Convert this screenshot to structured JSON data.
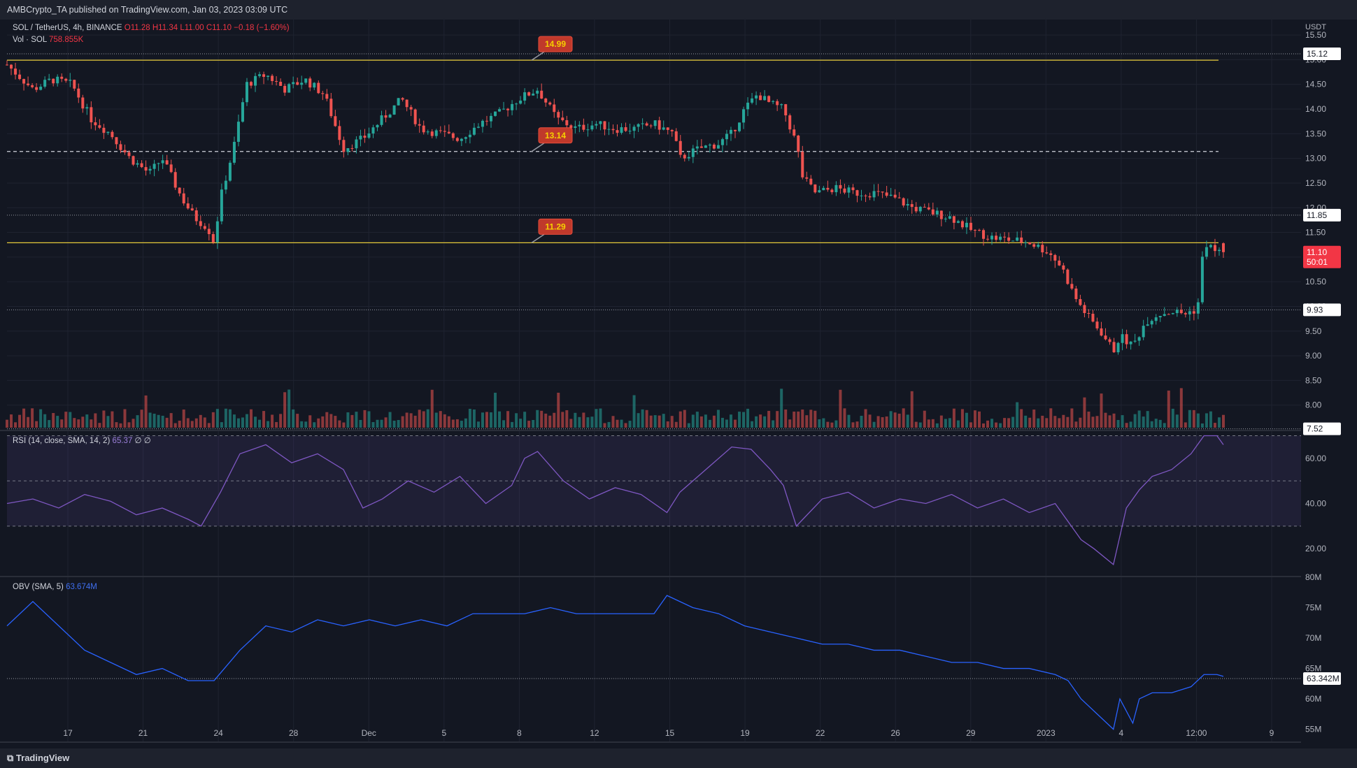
{
  "header": {
    "published": "AMBCrypto_TA published on TradingView.com, Jan 03, 2023 03:09 UTC"
  },
  "legend": {
    "symbol": "SOL / TetherUS, 4h, BINANCE",
    "o": "O11.28",
    "h": "H11.34",
    "l": "L11.00",
    "c": "C11.10",
    "change": "−0.18 (−1.60%)",
    "vol_label": "Vol · SOL",
    "vol_value": "758.855K",
    "rsi_label": "RSI (14, close, SMA, 14, 2)",
    "rsi_value": "65.37",
    "rsi_extra": "∅ ∅",
    "obv_label": "OBV (SMA, 5)",
    "obv_value": "63.674M"
  },
  "footer": {
    "brand": "TradingView"
  },
  "colors": {
    "background": "#131722",
    "up": "#26a69a",
    "down": "#ef5350",
    "level": "#e5c93a",
    "rsi": "#7e57c2",
    "obv": "#2962ff"
  },
  "chart_data": [
    {
      "type": "candlestick",
      "currency": "USDT",
      "y_ticks": [
        15.5,
        15.0,
        14.5,
        14.0,
        13.5,
        13.0,
        12.5,
        12.0,
        11.5,
        11.0,
        10.5,
        10.0,
        9.5,
        9.0,
        8.5,
        8.0
      ],
      "ylim": [
        7.5,
        15.7
      ],
      "x_labels": [
        "17",
        "21",
        "24",
        "28",
        "Dec",
        "5",
        "8",
        "12",
        "15",
        "19",
        "22",
        "26",
        "29",
        "2023",
        "4",
        "12:00",
        "9"
      ],
      "ohlc_current": {
        "open": 11.28,
        "high": 11.34,
        "low": 11.0,
        "close": 11.1
      },
      "price_badges": [
        "15.12",
        "11.85",
        "11.10",
        "9.93",
        "7.52"
      ],
      "countdown": "50:01",
      "levels": [
        {
          "label": "14.99",
          "value": 14.99,
          "style": "solid"
        },
        {
          "label": "13.14",
          "value": 13.14,
          "style": "dashed"
        },
        {
          "label": "11.29",
          "value": 11.29,
          "style": "solid"
        }
      ],
      "dotted_lines": [
        15.12,
        11.85,
        9.93,
        7.52
      ],
      "close_path": [
        [
          0,
          14.9
        ],
        [
          0.02,
          14.4
        ],
        [
          0.035,
          14.6
        ],
        [
          0.05,
          14.5
        ],
        [
          0.065,
          13.8
        ],
        [
          0.08,
          13.5
        ],
        [
          0.095,
          13.0
        ],
        [
          0.11,
          12.7
        ],
        [
          0.12,
          13.0
        ],
        [
          0.135,
          12.2
        ],
        [
          0.145,
          11.8
        ],
        [
          0.155,
          11.6
        ],
        [
          0.16,
          11.3
        ],
        [
          0.165,
          12.2
        ],
        [
          0.175,
          13.2
        ],
        [
          0.185,
          14.5
        ],
        [
          0.2,
          14.7
        ],
        [
          0.215,
          14.4
        ],
        [
          0.23,
          14.6
        ],
        [
          0.245,
          14.3
        ],
        [
          0.26,
          13.2
        ],
        [
          0.275,
          13.4
        ],
        [
          0.29,
          13.8
        ],
        [
          0.305,
          14.2
        ],
        [
          0.32,
          13.6
        ],
        [
          0.335,
          13.5
        ],
        [
          0.35,
          13.4
        ],
        [
          0.365,
          13.7
        ],
        [
          0.38,
          13.9
        ],
        [
          0.395,
          14.2
        ],
        [
          0.41,
          14.4
        ],
        [
          0.425,
          13.8
        ],
        [
          0.44,
          13.6
        ],
        [
          0.455,
          13.7
        ],
        [
          0.47,
          13.6
        ],
        [
          0.485,
          13.6
        ],
        [
          0.5,
          13.7
        ],
        [
          0.515,
          13.5
        ],
        [
          0.52,
          13.0
        ],
        [
          0.535,
          13.2
        ],
        [
          0.55,
          13.3
        ],
        [
          0.56,
          13.5
        ],
        [
          0.57,
          14.0
        ],
        [
          0.58,
          14.3
        ],
        [
          0.59,
          14.1
        ],
        [
          0.6,
          14.0
        ],
        [
          0.61,
          13.3
        ],
        [
          0.615,
          12.6
        ],
        [
          0.625,
          12.3
        ],
        [
          0.64,
          12.4
        ],
        [
          0.655,
          12.3
        ],
        [
          0.67,
          12.3
        ],
        [
          0.685,
          12.2
        ],
        [
          0.7,
          12.0
        ],
        [
          0.715,
          11.9
        ],
        [
          0.73,
          11.8
        ],
        [
          0.745,
          11.55
        ],
        [
          0.76,
          11.4
        ],
        [
          0.775,
          11.35
        ],
        [
          0.79,
          11.3
        ],
        [
          0.805,
          11.1
        ],
        [
          0.815,
          10.8
        ],
        [
          0.825,
          10.2
        ],
        [
          0.835,
          9.8
        ],
        [
          0.845,
          9.5
        ],
        [
          0.855,
          9.1
        ],
        [
          0.86,
          9.4
        ],
        [
          0.87,
          9.2
        ],
        [
          0.88,
          9.7
        ],
        [
          0.89,
          9.85
        ],
        [
          0.9,
          9.9
        ],
        [
          0.91,
          9.85
        ],
        [
          0.92,
          9.95
        ],
        [
          0.925,
          11.3
        ],
        [
          0.935,
          11.1
        ],
        [
          0.94,
          11.1
        ]
      ],
      "volume_label": "Vol · SOL",
      "volume_current": "758.855K"
    },
    {
      "type": "line",
      "name": "RSI (14, close, SMA, 14, 2)",
      "current": "65.37",
      "y_ticks": [
        60,
        40,
        20
      ],
      "ylim": [
        8,
        72
      ],
      "band": [
        30,
        70
      ],
      "midline": 50,
      "x": [
        0,
        0.02,
        0.04,
        0.06,
        0.08,
        0.1,
        0.12,
        0.14,
        0.15,
        0.165,
        0.18,
        0.2,
        0.22,
        0.24,
        0.26,
        0.275,
        0.29,
        0.31,
        0.33,
        0.35,
        0.37,
        0.39,
        0.4,
        0.41,
        0.43,
        0.45,
        0.47,
        0.49,
        0.51,
        0.52,
        0.54,
        0.56,
        0.575,
        0.59,
        0.6,
        0.61,
        0.63,
        0.65,
        0.67,
        0.69,
        0.71,
        0.73,
        0.75,
        0.77,
        0.79,
        0.81,
        0.82,
        0.83,
        0.84,
        0.855,
        0.865,
        0.875,
        0.885,
        0.9,
        0.915,
        0.925,
        0.935,
        0.94
      ],
      "values": [
        40,
        42,
        38,
        44,
        41,
        35,
        38,
        33,
        30,
        45,
        62,
        66,
        58,
        62,
        55,
        38,
        42,
        50,
        45,
        52,
        40,
        48,
        60,
        63,
        50,
        42,
        47,
        44,
        36,
        45,
        55,
        65,
        64,
        55,
        48,
        30,
        42,
        45,
        38,
        42,
        40,
        44,
        38,
        42,
        36,
        40,
        32,
        24,
        20,
        13,
        38,
        46,
        52,
        55,
        62,
        70,
        70,
        66
      ]
    },
    {
      "type": "line",
      "name": "OBV (SMA, 5)",
      "current": "63.674M",
      "y_ticks": [
        "80M",
        "75M",
        "70M",
        "65M",
        "60M",
        "55M"
      ],
      "ylim": [
        53,
        80
      ],
      "badge": "63.342M",
      "x": [
        0,
        0.02,
        0.04,
        0.06,
        0.08,
        0.1,
        0.12,
        0.14,
        0.16,
        0.18,
        0.2,
        0.22,
        0.24,
        0.26,
        0.28,
        0.3,
        0.32,
        0.34,
        0.36,
        0.38,
        0.4,
        0.42,
        0.44,
        0.46,
        0.48,
        0.5,
        0.51,
        0.53,
        0.55,
        0.57,
        0.59,
        0.61,
        0.63,
        0.65,
        0.67,
        0.69,
        0.71,
        0.73,
        0.75,
        0.77,
        0.79,
        0.81,
        0.82,
        0.83,
        0.84,
        0.85,
        0.855,
        0.86,
        0.87,
        0.875,
        0.885,
        0.9,
        0.915,
        0.925,
        0.935,
        0.94
      ],
      "values": [
        72,
        76,
        72,
        68,
        66,
        64,
        65,
        63,
        63,
        68,
        72,
        71,
        73,
        72,
        73,
        72,
        73,
        72,
        74,
        74,
        74,
        75,
        74,
        74,
        74,
        74,
        77,
        75,
        74,
        72,
        71,
        70,
        69,
        69,
        68,
        68,
        67,
        66,
        66,
        65,
        65,
        64,
        63,
        60,
        58,
        56,
        55,
        60,
        56,
        60,
        61,
        61,
        62,
        64,
        64,
        63.7
      ]
    }
  ]
}
